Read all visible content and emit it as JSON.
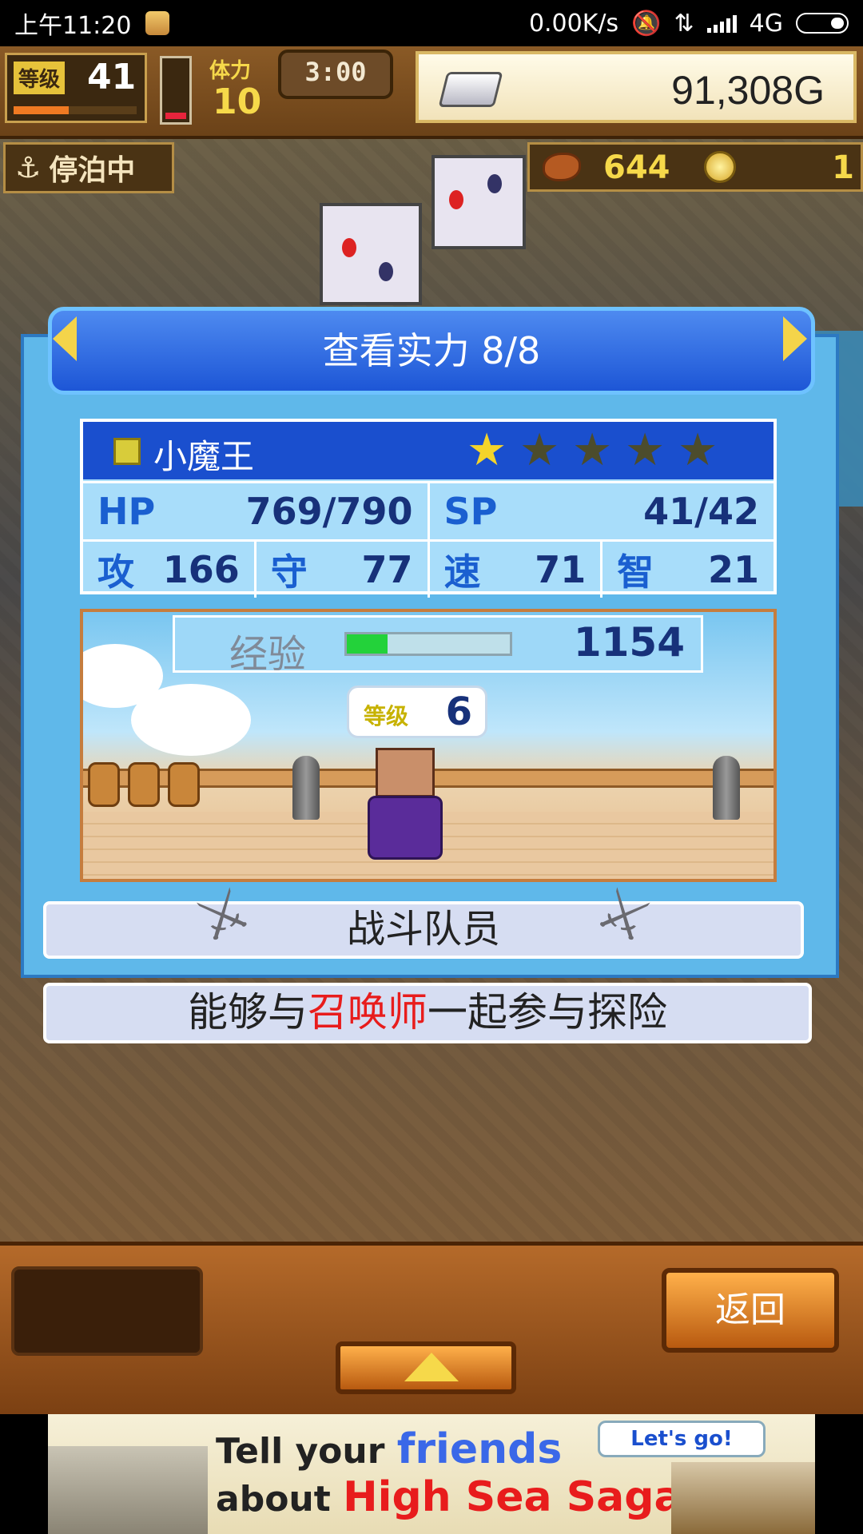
{
  "status_bar": {
    "time": "上午11:20",
    "network_speed": "0.00K/s",
    "network_type": "4G",
    "icons": [
      "app-notification-icon",
      "mute-icon",
      "data-transfer-icon",
      "signal-icon",
      "battery-icon"
    ]
  },
  "hud": {
    "level_label": "等级",
    "level_value": "41",
    "level_progress": 0.45,
    "stamina_fill": 0.2,
    "stamina_label": "体力",
    "stamina_value": "10",
    "timer": "3:00",
    "gold": "91,308G",
    "docked_label": "停泊中",
    "food_value": "644",
    "coin_value": "1"
  },
  "modal": {
    "title": "查看实力 8/8",
    "hero": {
      "name": "小魔王",
      "stars_total": 5,
      "stars_filled": 1
    },
    "stats": {
      "row1": [
        {
          "key": "HP",
          "value": "769/790"
        },
        {
          "key": "SP",
          "value": "41/42"
        }
      ],
      "row2": [
        {
          "key": "攻",
          "value": "166"
        },
        {
          "key": "守",
          "value": "77"
        },
        {
          "key": "速",
          "value": "71"
        },
        {
          "key": "智",
          "value": "21"
        }
      ]
    },
    "exp_label": "经验",
    "exp_progress": 0.25,
    "exp_value": "1154",
    "level_bubble_label": "等级",
    "level_bubble_value": "6",
    "role": "战斗队员"
  },
  "description": {
    "prefix": "能够与",
    "highlight": "召唤师",
    "suffix": "一起参与探险"
  },
  "bottom": {
    "back_label": "返回"
  },
  "ad": {
    "line1_a": "Tell your ",
    "line1_b": "friends",
    "line2_a": "about ",
    "line2_b": "High Sea Saga!",
    "cta": "Let's go!"
  },
  "colors": {
    "accent_blue": "#1a4fce",
    "panel_blue": "#5fb8ea",
    "highlight_red": "#e81c1c",
    "gold_yellow": "#f6d94a"
  }
}
